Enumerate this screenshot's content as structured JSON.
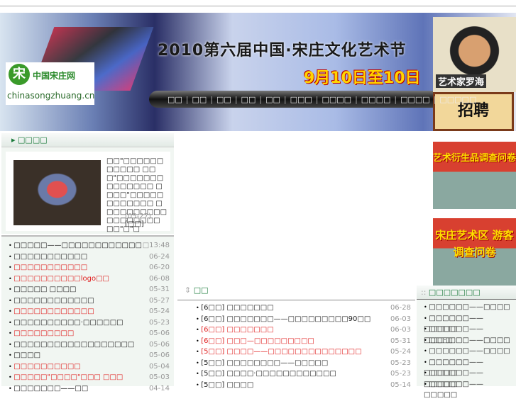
{
  "banner": {
    "title": "2010第六届中国·宋庄文化艺术节",
    "date": "9月10日至10日",
    "logo_mark": "宋",
    "logo_cn": "中国宋庄网",
    "logo_url": "chinasongzhuang.cn",
    "artist": "艺术家罗海",
    "recruit": "招聘"
  },
  "nav": [
    "□□",
    "□□",
    "□□",
    "□□",
    "□□",
    "□□□",
    "□□□□",
    "□□□□",
    "□□□□",
    "□□□□□"
  ],
  "feature": {
    "title": "□□□□",
    "text": "□□\"□□□□□□□□□□□ □□□\"□□□□□□□□□□□□□□ □□□□\"□□□□□□□□□□□□ □□□□□□□□□□□□□□□□□□ □□\"□\"□",
    "date": "(05-27)",
    "more": "[□□]"
  },
  "left_list": [
    {
      "t": "□□□□□——□□□□□□□□□□□□",
      "d": "□13:48",
      "red": false
    },
    {
      "t": "□□□□□□□□□□□",
      "d": "06-24",
      "red": false
    },
    {
      "t": "□□□□□□□□□□□",
      "d": "06-20",
      "red": true
    },
    {
      "t": "□□□□□□□□□□logo□□",
      "d": "06-08",
      "red": true
    },
    {
      "t": "□□□□□ □□□□",
      "d": "05-31",
      "red": false
    },
    {
      "t": "□□□□□□□□□□□□",
      "d": "05-27",
      "red": false
    },
    {
      "t": "□□□□□□□□□□□□",
      "d": "05-24",
      "red": true
    },
    {
      "t": "□□□□□□□□□□·□□□□□□",
      "d": "05-23",
      "red": false
    },
    {
      "t": "□□□□□□□□□",
      "d": "05-06",
      "red": true
    },
    {
      "t": "□□□□□□□□□□□□□□□□□□",
      "d": "05-06",
      "red": false
    },
    {
      "t": "□□□□",
      "d": "05-06",
      "red": false
    },
    {
      "t": "□□□□□□□□□□",
      "d": "05-04",
      "red": true
    },
    {
      "t": "□□□□□\"□□□□\"□□□ □□□",
      "d": "05-03",
      "red": true
    },
    {
      "t": "□□□□□□□——□□",
      "d": "04-14",
      "red": false
    }
  ],
  "news": {
    "title": "□□",
    "items": [
      {
        "t": "[6□□] □□□□□□□",
        "d": "06-28",
        "red": false
      },
      {
        "t": "[6□□] □□□□□□□——□□□□□□□□□90□□",
        "d": "06-03",
        "red": false
      },
      {
        "t": "[6□□] □□□□□□□",
        "d": "06-03",
        "red": true
      },
      {
        "t": "[6□□] □□□—□□□□□□□□□",
        "d": "05-31",
        "red": true
      },
      {
        "t": "[5□□] □□□□——□□□□□□□□□□□□□□",
        "d": "05-24",
        "red": true
      },
      {
        "t": "[5□□] □□□□□□□□——□□□□□",
        "d": "05-23",
        "red": false
      },
      {
        "t": "[5□□] □□□□·□□□□□□□□□□□□",
        "d": "05-23",
        "red": false
      },
      {
        "t": "[5□□] □□□□",
        "d": "05-14",
        "red": false
      }
    ]
  },
  "ads": [
    "艺术衍生品调查问卷",
    "宋庄艺术区 游客调查问卷"
  ],
  "right": {
    "title": "□□□□□□□",
    "items": [
      "□□□□□□——□□□□",
      "□□□□□□——□□□□□",
      "□□□□□□——□□□·□",
      "□□□□□□——□□□□",
      "□□□□□□——□□□□",
      "□□□□□□——□□□□□",
      "□□□□□□——□□□□□",
      "□□□□□□——□□□□□"
    ]
  }
}
